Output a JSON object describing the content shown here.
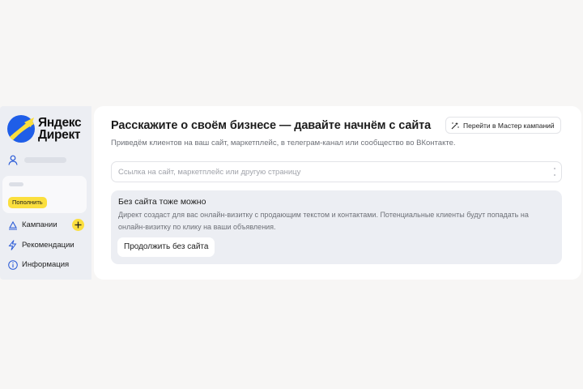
{
  "logo": {
    "text": "Яндекс Директ",
    "line1": "Яндекс",
    "line2": "Директ"
  },
  "sidebar": {
    "topup_label": "Пополнить",
    "items": [
      {
        "label": "Кампании",
        "icon": "campaigns-icon"
      },
      {
        "label": "Рекомендации",
        "icon": "lightning-icon"
      },
      {
        "label": "Информация",
        "icon": "info-icon"
      }
    ]
  },
  "main": {
    "title": "Расскажите о своём бизнесе — давайте начнём с сайта",
    "wizard_button": "Перейти в Мастер кампаний",
    "subtitle": "Приведём клиентов на ваш сайт, маркетплейс, в телеграм-канал или сообщество во ВКонтакте.",
    "url_input": {
      "value": "",
      "placeholder": "Ссылка на сайт, маркетплейс или другую страницу"
    },
    "no_site": {
      "title": "Без сайта тоже можно",
      "text": "Директ создаст для вас онлайн-визитку с продающим текстом и контактами. Потенциальные клиенты будут попадать на онлайн-визитку по клику на ваши объявления.",
      "button": "Продолжить без сайта"
    }
  },
  "colors": {
    "accent_yellow": "#fbdf3e",
    "logo_blue": "#1f5ee8",
    "panel_gray": "#eceef3"
  }
}
